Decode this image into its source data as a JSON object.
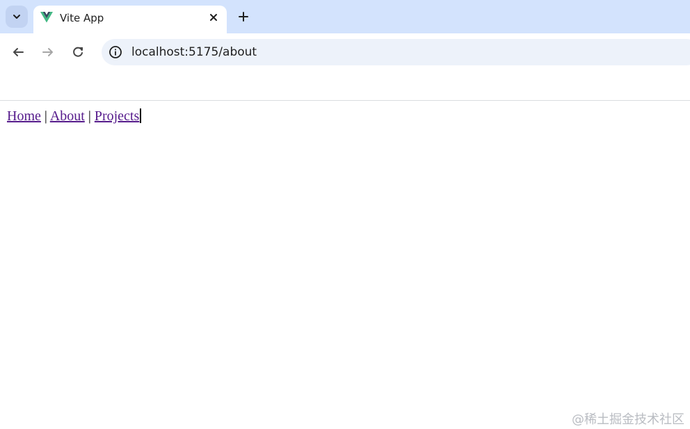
{
  "browser": {
    "tab": {
      "title": "Vite App",
      "favicon": "vue-logo-icon",
      "close_symbol": "✕"
    },
    "new_tab_symbol": "+",
    "address_bar": {
      "url": "localhost:5175/about"
    },
    "icons": {
      "tab_search": "chevron-down-icon",
      "back": "arrow-left-icon",
      "forward": "arrow-right-icon",
      "reload": "reload-icon",
      "site_info": "info-icon"
    },
    "colors": {
      "tabstrip": "#d3e3fd",
      "omnibox": "#edf2fa",
      "vue_green": "#41b883",
      "vue_dark": "#35495e"
    }
  },
  "page": {
    "nav": {
      "home": "Home",
      "about": "About",
      "projects": "Projects",
      "separator": "|",
      "link_color": "#551a8b"
    }
  },
  "watermark": "@稀土掘金技术社区"
}
